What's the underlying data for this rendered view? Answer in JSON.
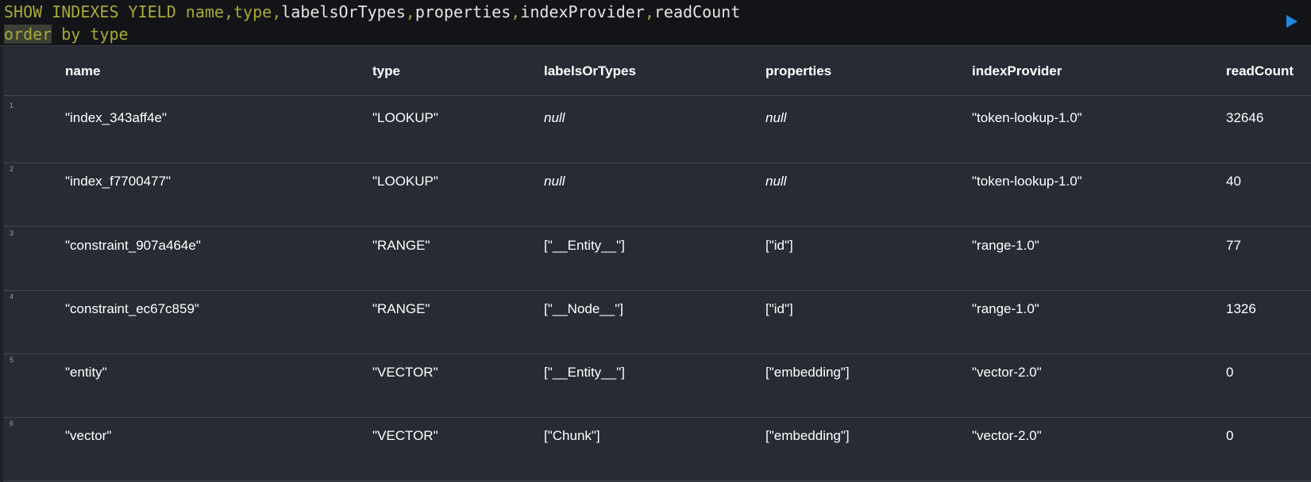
{
  "editor": {
    "line1_keyword": "SHOW INDEXES YIELD",
    "line1_sep": " ",
    "line1_fields": [
      {
        "name": "name",
        "color": "keyword"
      },
      {
        "name": "type",
        "color": "keyword"
      },
      {
        "name": "labelsOrTypes",
        "color": "text"
      },
      {
        "name": "properties",
        "color": "text"
      },
      {
        "name": "indexProvider",
        "color": "text"
      },
      {
        "name": "readCount",
        "color": "text"
      }
    ],
    "line2_order": "order",
    "line2_by": " by ",
    "line2_type": "type",
    "run_icon": "play-icon",
    "accent_color": "#1e88e5"
  },
  "table": {
    "headers": [
      "name",
      "type",
      "labelsOrTypes",
      "properties",
      "indexProvider",
      "readCount"
    ],
    "rows": [
      {
        "num": "1",
        "name": "\"index_343aff4e\"",
        "type": "\"LOOKUP\"",
        "labelsOrTypes": "null",
        "properties": "null",
        "indexProvider": "\"token-lookup-1.0\"",
        "readCount": "32646"
      },
      {
        "num": "2",
        "name": "\"index_f7700477\"",
        "type": "\"LOOKUP\"",
        "labelsOrTypes": "null",
        "properties": "null",
        "indexProvider": "\"token-lookup-1.0\"",
        "readCount": "40"
      },
      {
        "num": "3",
        "name": "\"constraint_907a464e\"",
        "type": "\"RANGE\"",
        "labelsOrTypes": "[\"__Entity__\"]",
        "properties": "[\"id\"]",
        "indexProvider": "\"range-1.0\"",
        "readCount": "77"
      },
      {
        "num": "4",
        "name": "\"constraint_ec67c859\"",
        "type": "\"RANGE\"",
        "labelsOrTypes": "[\"__Node__\"]",
        "properties": "[\"id\"]",
        "indexProvider": "\"range-1.0\"",
        "readCount": "1326"
      },
      {
        "num": "5",
        "name": "\"entity\"",
        "type": "\"VECTOR\"",
        "labelsOrTypes": "[\"__Entity__\"]",
        "properties": "[\"embedding\"]",
        "indexProvider": "\"vector-2.0\"",
        "readCount": "0"
      },
      {
        "num": "6",
        "name": "\"vector\"",
        "type": "\"VECTOR\"",
        "labelsOrTypes": "[\"Chunk\"]",
        "properties": "[\"embedding\"]",
        "indexProvider": "\"vector-2.0\"",
        "readCount": "0"
      }
    ]
  }
}
